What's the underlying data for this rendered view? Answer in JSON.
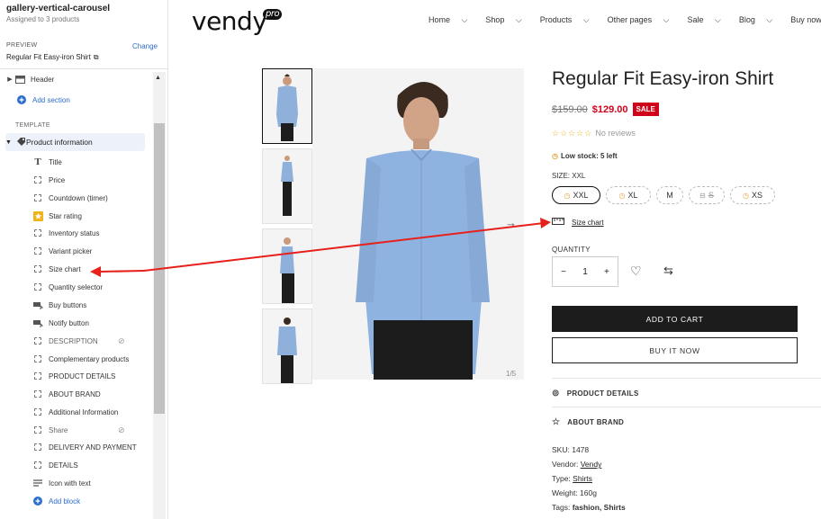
{
  "sidebar": {
    "title": "gallery-vertical-carousel",
    "subtitle": "Assigned to 3 products",
    "preview_label": "PREVIEW",
    "change_label": "Change",
    "preview_value": "Regular Fit Easy-iron Shirt",
    "header_label": "Header",
    "add_section_label": "Add section",
    "template_label": "TEMPLATE",
    "product_info_label": "Product information",
    "blocks": [
      {
        "label": "Title",
        "icon": "title-icon"
      },
      {
        "label": "Price",
        "icon": "block-icon"
      },
      {
        "label": "Countdown (timer)",
        "icon": "block-icon"
      },
      {
        "label": "Star rating",
        "icon": "star-icon"
      },
      {
        "label": "Inventory status",
        "icon": "block-icon"
      },
      {
        "label": "Variant picker",
        "icon": "block-icon"
      },
      {
        "label": "Size chart",
        "icon": "block-icon"
      },
      {
        "label": "Quantity selector",
        "icon": "block-icon"
      },
      {
        "label": "Buy buttons",
        "icon": "buy-buttons-icon"
      },
      {
        "label": "Notify button",
        "icon": "buy-buttons-icon"
      },
      {
        "label": "DESCRIPTION",
        "icon": "block-icon",
        "hidden": true
      },
      {
        "label": "Complementary products",
        "icon": "block-icon"
      },
      {
        "label": "PRODUCT DETAILS",
        "icon": "block-icon"
      },
      {
        "label": "ABOUT BRAND",
        "icon": "block-icon"
      },
      {
        "label": "Additional Information",
        "icon": "block-icon"
      },
      {
        "label": "Share",
        "icon": "block-icon",
        "hidden": true
      },
      {
        "label": "DELIVERY AND PAYMENT",
        "icon": "block-icon"
      },
      {
        "label": "DETAILS",
        "icon": "block-icon"
      },
      {
        "label": "Icon with text",
        "icon": "icon-with-text-icon"
      }
    ],
    "add_block_label": "Add block"
  },
  "store": {
    "logo": "vendy",
    "logo_badge": "pro",
    "nav": [
      "Home",
      "Shop",
      "Products",
      "Other pages",
      "Sale",
      "Blog",
      "Buy now!"
    ]
  },
  "product": {
    "title": "Regular Fit Easy-iron Shirt",
    "old_price": "$159.00",
    "price": "$129.00",
    "sale_badge": "SALE",
    "rating_text": "No reviews",
    "stock_text": "Low stock: 5 left",
    "size_label": "SIZE: XXL",
    "sizes": [
      "XXL",
      "XL",
      "M",
      "S",
      "XS"
    ],
    "selected_size": "XXL",
    "size_chart_label": "Size chart",
    "quantity_label": "QUANTITY",
    "quantity": "1",
    "add_to_cart_label": "ADD TO CART",
    "buy_now_label": "BUY IT NOW",
    "accordions": [
      "PRODUCT DETAILS",
      "ABOUT BRAND"
    ],
    "image_counter": "1/5",
    "meta": {
      "sku_label": "SKU:",
      "sku": "1478",
      "vendor_label": "Vendor:",
      "vendor": "Vendy",
      "type_label": "Type:",
      "type": "Shirts",
      "weight_label": "Weight:",
      "weight": "160g",
      "tags_label": "Tags:",
      "tags": "fashion, Shirts"
    }
  },
  "colors": {
    "accent": "#2c6ecb",
    "sale": "#d0021b",
    "arrow": "#e8201c"
  }
}
